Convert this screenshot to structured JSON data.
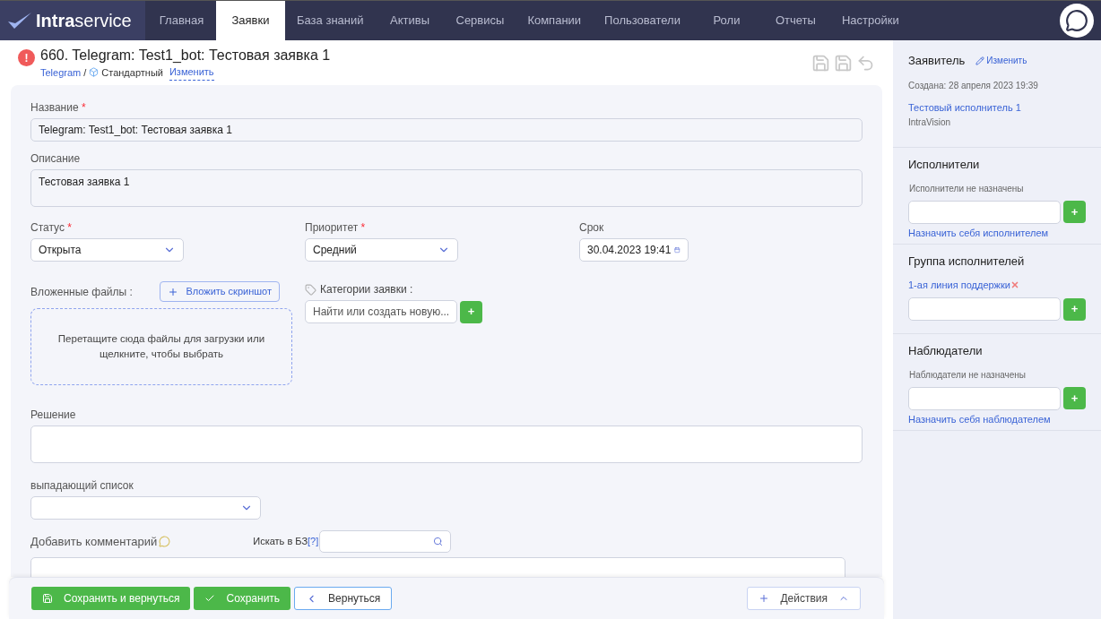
{
  "logo": "**Intra**service",
  "nav": [
    {
      "label": "Главная",
      "selected": false
    },
    {
      "label": "Заявки",
      "selected": true
    },
    {
      "label": "База знаний",
      "selected": false
    },
    {
      "label": "Активы",
      "selected": false
    },
    {
      "label": "Сервисы",
      "selected": false
    },
    {
      "label": "Компании",
      "selected": false
    },
    {
      "label": "Пользователи",
      "selected": false
    },
    {
      "label": "Роли",
      "selected": false
    },
    {
      "label": "Отчеты",
      "selected": false
    },
    {
      "label": "Настройки",
      "selected": false
    }
  ],
  "header": {
    "alert": "!",
    "title": "660. Telegram: Test1_bot: Тестовая заявка 1",
    "service": "Telegram",
    "separator": "/",
    "type": "Стандартный",
    "change": "Изменить"
  },
  "form": {
    "name": {
      "label": "Название",
      "required_mark": "*",
      "value": "Telegram: Test1_bot: Тестовая заявка 1"
    },
    "description": {
      "label": "Описание",
      "value": "Тестовая заявка 1"
    },
    "status": {
      "label": "Статус",
      "required_mark": "*",
      "value": "Открыта"
    },
    "priority": {
      "label": "Приоритет",
      "required_mark": "*",
      "value": "Средний"
    },
    "deadline": {
      "label": "Срок",
      "value": "30.04.2023 19:41"
    },
    "attachments": {
      "label": "Вложенные файлы :",
      "button": "Вложить скриншот",
      "drop_text": "Перетащите сюда файлы для загрузки или щелкните, чтобы выбрать"
    },
    "categories": {
      "label": "Категории заявки :",
      "placeholder": "Найти или создать новую...",
      "add": "+"
    },
    "solution": {
      "label": "Решение"
    },
    "dropdown": {
      "label": "выпадающий список"
    },
    "comment": {
      "label": "Добавить комментарий",
      "kb_label": "Искать в БЗ",
      "kb_help": "[?]"
    }
  },
  "footer": {
    "buttons": [
      {
        "label": "Сохранить и вернуться",
        "kind": "save_back"
      },
      {
        "label": "Сохранить",
        "kind": "save"
      },
      {
        "label": "Вернуться",
        "kind": "back"
      }
    ],
    "actions": "Действия"
  },
  "sidebar": {
    "applicant": {
      "title": "Заявитель",
      "change": "Изменить",
      "created": "Создана: 28 апреля 2023 19:39",
      "person": "Тестовый исполнитель 1",
      "company": "IntraVision"
    },
    "sections": [
      {
        "title": "Исполнители",
        "note": "Исполнители не назначены",
        "add": "+",
        "link": "Назначить себя исполнителем"
      },
      {
        "title": "Группа исполнителей",
        "tag": "1-ая линия поддержки",
        "add": "+"
      },
      {
        "title": "Наблюдатели",
        "note": "Наблюдатели не назначены",
        "add": "+",
        "link": "Назначить себя наблюдателем"
      }
    ]
  }
}
